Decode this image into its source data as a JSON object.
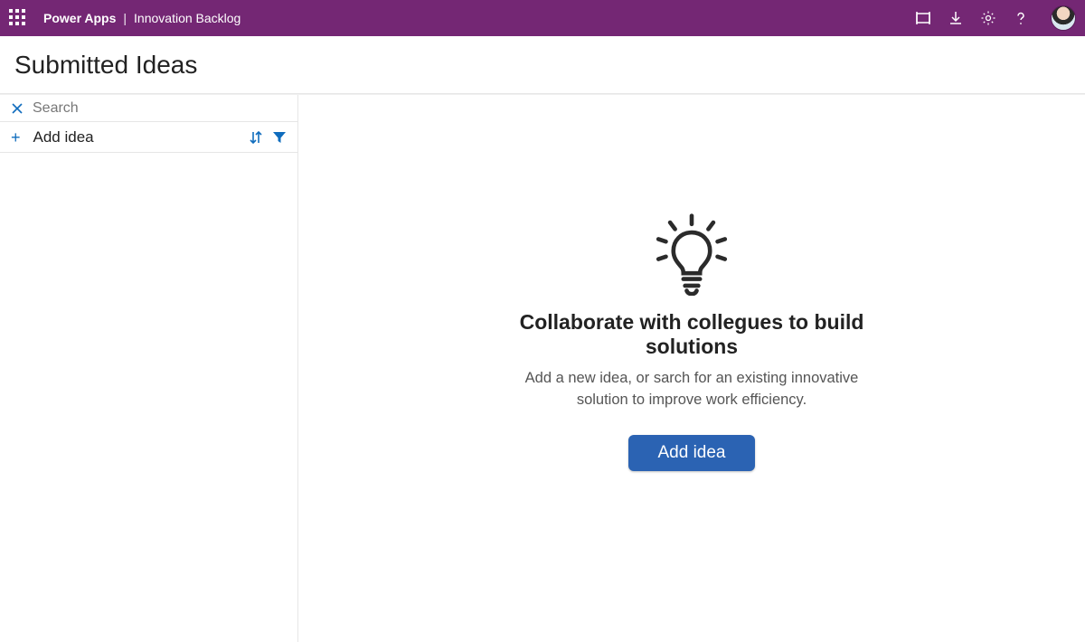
{
  "topbar": {
    "brand": "Power Apps",
    "divider": "|",
    "app_name": "Innovation Backlog"
  },
  "page": {
    "title": "Submitted Ideas"
  },
  "sidebar": {
    "search_placeholder": "Search",
    "add_idea_label": "Add idea"
  },
  "empty_state": {
    "heading": "Collaborate with collegues to build solutions",
    "subtext": "Add a new idea, or sarch for an existing innovative solution to improve work efficiency.",
    "button_label": "Add idea"
  }
}
